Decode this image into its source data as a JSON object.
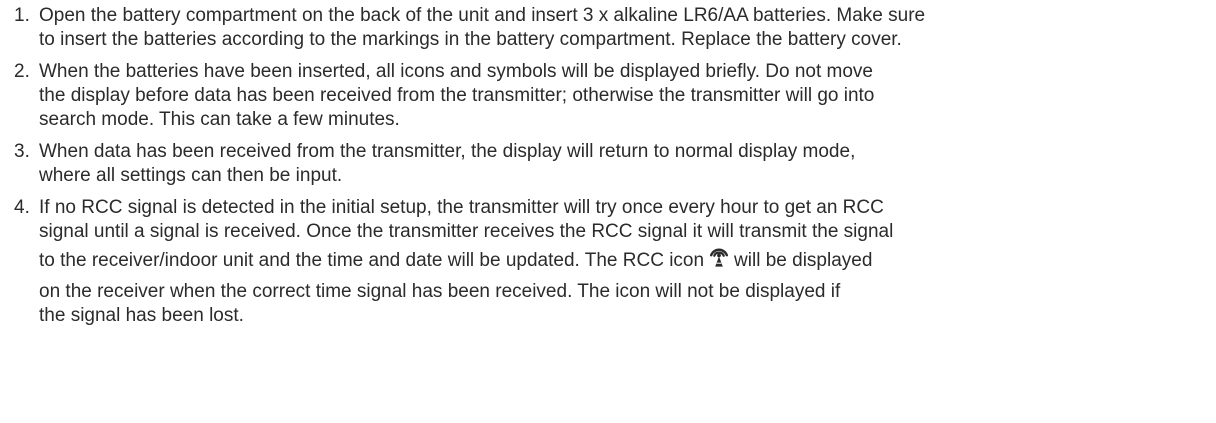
{
  "steps": [
    {
      "number": "1.",
      "lines": [
        "Open the battery compartment on the back of the unit and insert 3 x alkaline LR6/AA batteries. Make sure",
        "to insert the batteries according to the markings in the battery compartment. Replace the battery cover."
      ]
    },
    {
      "number": "2.",
      "lines": [
        "When the batteries have been inserted, all icons and symbols will be displayed briefly. Do not move",
        "the display before data has been received from the transmitter; otherwise the transmitter will go into",
        "search mode. This can take a few minutes."
      ]
    },
    {
      "number": "3.",
      "lines": [
        "When data has been received from the transmitter, the display will return to normal display mode,",
        "where all settings can then be input."
      ]
    },
    {
      "number": "4.",
      "lines": [
        "If no RCC signal is detected in the initial setup, the transmitter will try once every hour to get an RCC",
        "signal until a signal is received. Once the transmitter receives the RCC signal it will transmit the signal"
      ],
      "icon_line_before": "to the receiver/indoor unit and the time and date will be updated. The RCC icon",
      "icon_line_after": "will be displayed",
      "icon_name": "rcc-signal-tower-icon",
      "lines_after": [
        "on the receiver when the correct time signal has been received. The icon will not be displayed if",
        "the signal has been lost."
      ]
    }
  ]
}
